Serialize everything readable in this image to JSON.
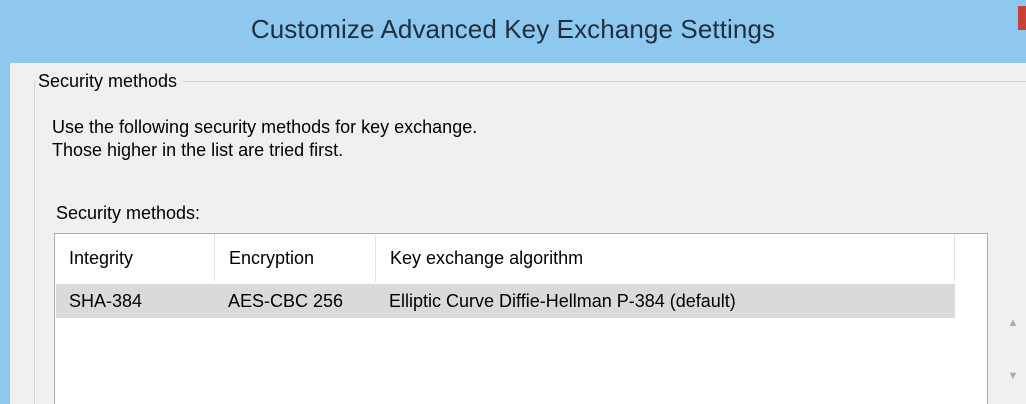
{
  "window": {
    "title": "Customize Advanced Key Exchange Settings"
  },
  "group": {
    "legend": "Security methods",
    "description_line1": "Use the following security methods for key exchange.",
    "description_line2": "Those higher in the list are tried first.",
    "list_label": "Security methods:"
  },
  "table": {
    "columns": [
      "Integrity",
      "Encryption",
      "Key exchange algorithm"
    ],
    "rows": [
      [
        "SHA-384",
        "AES-CBC 256",
        "Elliptic Curve Diffie-Hellman P-384 (default)"
      ]
    ]
  },
  "buttons": {
    "move_up_icon": "▲",
    "move_down_icon": "▼"
  }
}
